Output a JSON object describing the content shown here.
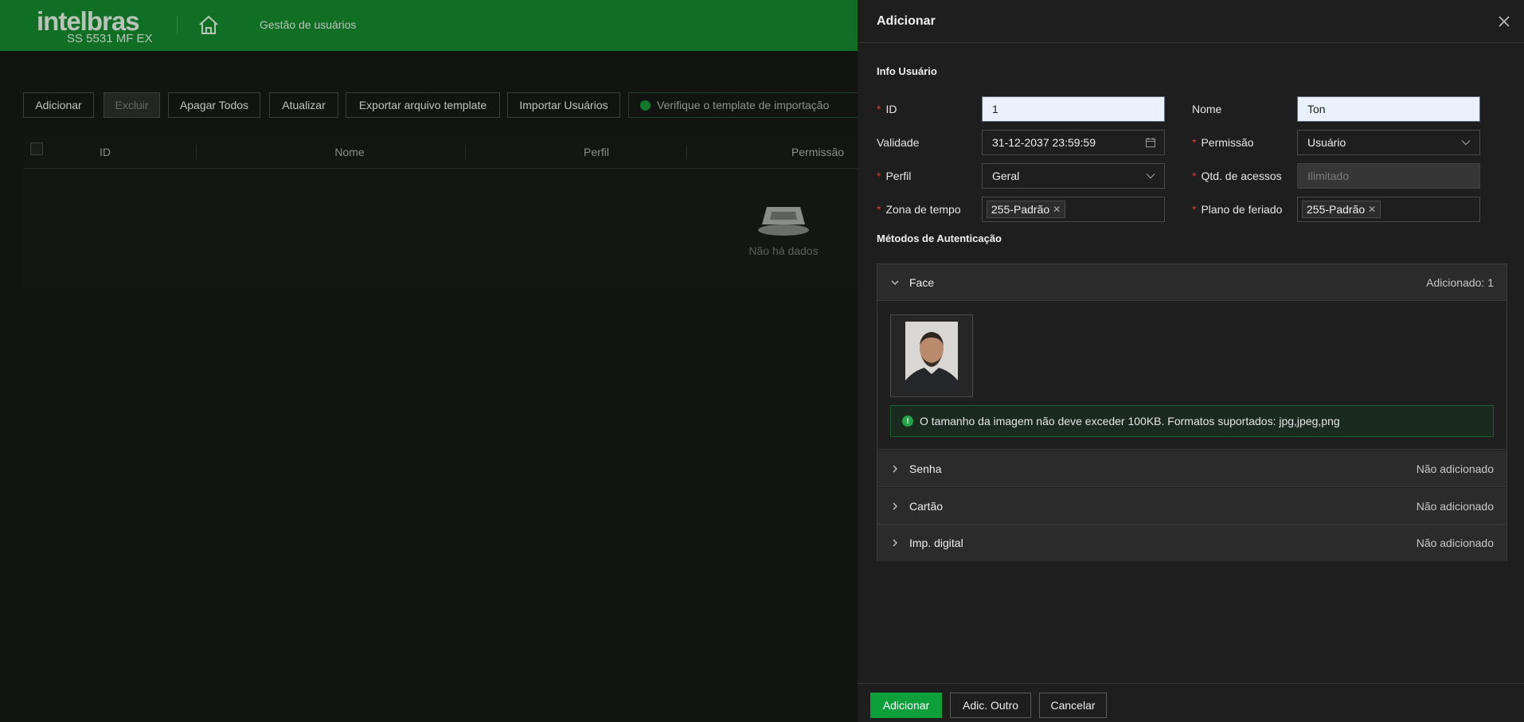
{
  "header": {
    "logo_text": "intelbras",
    "model": "SS 5531 MF EX",
    "breadcrumb": "Gestão de usuários",
    "colors": {
      "header_bg": "#116f25",
      "accent": "#0d9f3a"
    }
  },
  "toolbar": {
    "add": "Adicionar",
    "delete": "Excluir",
    "clear_all": "Apagar Todos",
    "refresh": "Atualizar",
    "export_template": "Exportar arquivo template",
    "import_users": "Importar Usuários",
    "notice": "Verifique o template de importação"
  },
  "table": {
    "columns": [
      "ID",
      "Nome",
      "Perfil",
      "Permissão"
    ],
    "empty_text": "Não há dados"
  },
  "drawer": {
    "title": "Adicionar",
    "user_info_title": "Info Usuário",
    "fields": {
      "id": {
        "label": "ID",
        "value": "1"
      },
      "name": {
        "label": "Nome",
        "value": "Ton"
      },
      "validity": {
        "label": "Validade",
        "value": "31-12-2037 23:59:59"
      },
      "permission": {
        "label": "Permissão",
        "value": "Usuário"
      },
      "profile": {
        "label": "Perfil",
        "value": "Geral"
      },
      "access_count": {
        "label": "Qtd. de acessos",
        "placeholder": "Ilimitado"
      },
      "time_zone": {
        "label": "Zona de tempo",
        "tag": "255-Padrão"
      },
      "holiday_plan": {
        "label": "Plano de feriado",
        "tag": "255-Padrão"
      }
    },
    "auth_title": "Métodos de Autenticação",
    "auth_methods": [
      {
        "label": "Face",
        "status": "Adicionado: 1",
        "expanded": true
      },
      {
        "label": "Senha",
        "status": "Não adicionado",
        "expanded": false
      },
      {
        "label": "Cartão",
        "status": "Não adicionado",
        "expanded": false
      },
      {
        "label": "Imp. digital",
        "status": "Não adicionado",
        "expanded": false
      }
    ],
    "face_info": "O tamanho da imagem não deve exceder 100KB. Formatos suportados: jpg,jpeg,png",
    "footer": {
      "add": "Adicionar",
      "add_another": "Adic. Outro",
      "cancel": "Cancelar"
    }
  }
}
